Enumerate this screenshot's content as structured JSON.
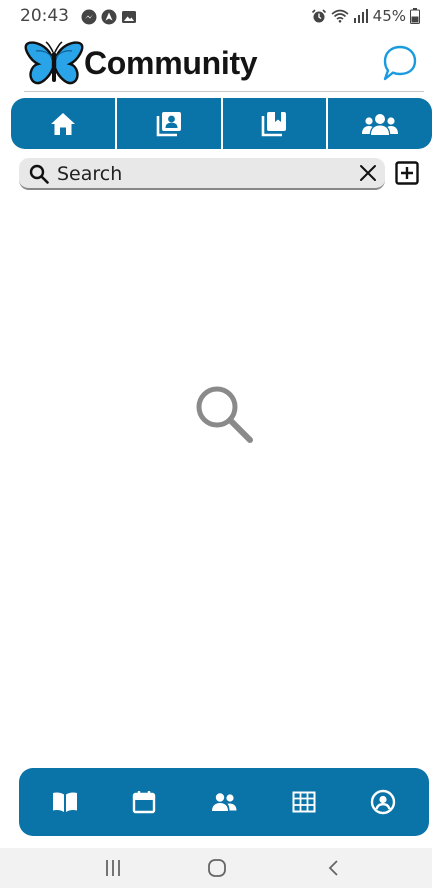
{
  "status_bar": {
    "time": "20:43",
    "battery": "45%",
    "left_icons": [
      "messenger-icon",
      "navigation-icon",
      "image-icon"
    ],
    "right_icons": [
      "alarm-icon",
      "wifi-icon",
      "signal-icon",
      "battery-icon"
    ]
  },
  "header": {
    "title": "Community",
    "logo_icon": "butterfly-logo",
    "chat_icon": "chat-bubble-icon"
  },
  "tabs": [
    {
      "name": "home",
      "icon": "home-icon",
      "active": true
    },
    {
      "name": "profiles",
      "icon": "contact-book-icon",
      "active": false
    },
    {
      "name": "bookmarks",
      "icon": "bookmark-stack-icon",
      "active": false
    },
    {
      "name": "groups",
      "icon": "people-icon",
      "active": false
    }
  ],
  "search": {
    "placeholder": "Search",
    "value": ""
  },
  "bottom_nav": [
    {
      "name": "guide",
      "icon": "book-icon"
    },
    {
      "name": "calendar",
      "icon": "calendar-icon"
    },
    {
      "name": "people",
      "icon": "people-icon"
    },
    {
      "name": "table",
      "icon": "grid-icon"
    },
    {
      "name": "account",
      "icon": "user-circle-icon"
    }
  ],
  "colors": {
    "primary": "#0a73a7",
    "accent_light": "#1a9be0",
    "background": "#ffffff",
    "search_bg": "#e8e8e8"
  }
}
